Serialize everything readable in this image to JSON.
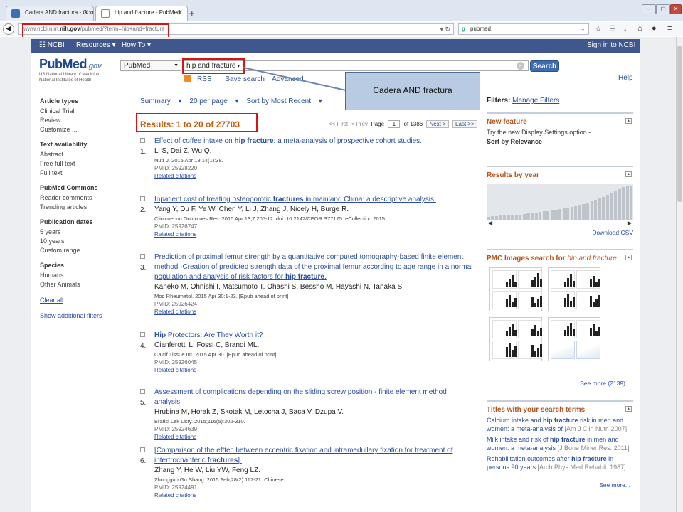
{
  "browser": {
    "tabs": [
      {
        "title": "Cadera AND fractura - Goo...",
        "active": false
      },
      {
        "title": "hip and fracture - PubMed ...",
        "active": true
      }
    ],
    "url": {
      "prefix": "www.ncbi.nlm.",
      "domain": "nih.gov",
      "path": "/pubmed/?term=hip+and+fracture"
    },
    "web_search_value": "pubmed"
  },
  "ncbi_bar": {
    "logo": "NCBI",
    "resources": "Resources",
    "howto": "How To",
    "signin": "Sign in to NCBI"
  },
  "pubmed": {
    "logo_text": "PubMed",
    "logo_suffix": ".gov",
    "logo_sub1": "US National Library of Medicine",
    "logo_sub2": "National Institutes of Health",
    "db_value": "PubMed",
    "query": "hip and fracture",
    "search_button": "Search",
    "rss": "RSS",
    "save_search": "Save search",
    "advanced": "Advanced",
    "help": "Help"
  },
  "callout": {
    "text": "Cadera AND fractura"
  },
  "left_filters": {
    "groups": [
      {
        "heading": "Article types",
        "items": [
          "Clinical Trial",
          "Review",
          "Customize ..."
        ]
      },
      {
        "heading": "Text availability",
        "items": [
          "Abstract",
          "Free full text",
          "Full text"
        ]
      },
      {
        "heading": "PubMed Commons",
        "items": [
          "Reader comments",
          "Trending articles"
        ]
      },
      {
        "heading": "Publication dates",
        "items": [
          "5 years",
          "10 years",
          "Custom range..."
        ]
      },
      {
        "heading": "Species",
        "items": [
          "Humans",
          "Other Animals"
        ]
      }
    ],
    "clear_all": "Clear all",
    "show_additional": "Show additional filters"
  },
  "display": {
    "summary": "Summary",
    "per_page": "20 per page",
    "sort": "Sort by Most Recent"
  },
  "results_count": "Results: 1 to 20 of 27703",
  "pager": {
    "first": "<< First",
    "prev": "< Prev",
    "page_label": "Page",
    "page_value": "1",
    "of": "of 1386",
    "next": "Next >",
    "last": "Last >>"
  },
  "results": [
    {
      "num": "1.",
      "title_parts": [
        "Effect of coffee intake on ",
        "hip fracture",
        ": a meta-analysis of prospective cohort studies."
      ],
      "authors": "Li S, Dai Z, Wu Q.",
      "cite": "Nutr J. 2015 Apr 18;14(1):38.",
      "pmid": "PMID: 25928220",
      "related": "Related citations"
    },
    {
      "num": "2.",
      "title_parts": [
        "Inpatient cost of treating osteoporotic ",
        "fractures",
        " in mainland China: a descriptive analysis."
      ],
      "authors": "Yang Y, Du F, Ye W, Chen Y, Li J, Zhang J, Nicely H, Burge R.",
      "cite": "Clinicoecon Outcomes Res. 2015 Apr 13;7:205-12. doi: 10.2147/CEOR.S77175. eCollection 2015.",
      "pmid": "PMID: 25926747",
      "related": "Related citations"
    },
    {
      "num": "3.",
      "title_parts": [
        "Prediction of proximal femur strength by a quantitative computed tomography-based finite element method -Creation of predicted strength data of the proximal femur according to age range in a normal population and analysis of risk factors for ",
        "hip fracture",
        "."
      ],
      "authors": "Kaneko M, Ohnishi I, Matsumoto T, Ohashi S, Bessho M, Hayashi N, Tanaka S.",
      "cite": "Mod Rheumatol. 2015 Apr 30:1-23. [Epub ahead of print]",
      "pmid": "PMID: 25926424",
      "related": "Related citations"
    },
    {
      "num": "4.",
      "title_parts": [
        "",
        "Hip",
        " Protectors: Are They Worth it?"
      ],
      "authors": "Cianferotti L, Fossi C, Brandi ML.",
      "cite": "Calcif Tissue Int. 2015 Apr 30. [Epub ahead of print]",
      "pmid": "PMID: 25926045",
      "related": "Related citations"
    },
    {
      "num": "5.",
      "title_parts": [
        "Assessment of complications depending on the sliding screw position - finite element method analysis.",
        "",
        ""
      ],
      "authors": "Hrubina M, Horak Z, Skotak M, Letocha J, Baca V, Dzupa V.",
      "cite": "Bratisl Lek Listy. 2015;116(5):302-310.",
      "pmid": "PMID: 25924639",
      "related": "Related citations"
    },
    {
      "num": "6.",
      "title_parts": [
        "[Comparison of the efftec between eccentric fixation and intramedullary fixation for treatment of intertrochanteric ",
        "fractures",
        "]."
      ],
      "authors": "Zhang Y, He W, Liu YW, Feng LZ.",
      "cite": "Zhongguo Gu Shang. 2015 Feb;28(2):117-21. Chinese.",
      "pmid": "PMID: 25924491",
      "related": "Related citations"
    }
  ],
  "right_sidebar": {
    "filters_label": "Filters:",
    "manage_filters": "Manage Filters",
    "new_feature": {
      "heading": "New feature",
      "line1": "Try the new Display Settings option -",
      "line2": "Sort by Relevance"
    },
    "results_by_year": {
      "heading": "Results by year",
      "download": "Download CSV",
      "bar_levels": [
        0.08,
        0.1,
        0.1,
        0.12,
        0.12,
        0.13,
        0.14,
        0.15,
        0.15,
        0.16,
        0.18,
        0.19,
        0.2,
        0.22,
        0.24,
        0.25,
        0.27,
        0.29,
        0.31,
        0.33,
        0.35,
        0.38,
        0.4,
        0.43,
        0.46,
        0.5,
        0.54,
        0.58,
        0.62,
        0.67,
        0.72,
        0.78,
        0.85,
        0.9,
        0.96,
        1.0,
        0.98
      ]
    },
    "pmc_images": {
      "heading": "PMC Images search for ",
      "query": "hip and fracture",
      "see_more": "See more (2139)..."
    },
    "titles": {
      "heading": "Titles with your search terms",
      "items": [
        {
          "parts": [
            "Calcium intake and ",
            "hip fracture",
            " risk in men and women: a meta-analysis of "
          ],
          "journal": "[Am J Clin Nutr. 2007]"
        },
        {
          "parts": [
            "Milk intake and risk of ",
            "hip fracture",
            " in men and women: a meta-analysis "
          ],
          "journal": "[J Bone Miner Res. 2011]"
        },
        {
          "parts": [
            "Rehabilitation outcomes after ",
            "hip fracture",
            " in persons 90 years "
          ],
          "journal": "[Arch Phys Med Rehabil. 1987]"
        }
      ],
      "see_more": "See more..."
    }
  }
}
